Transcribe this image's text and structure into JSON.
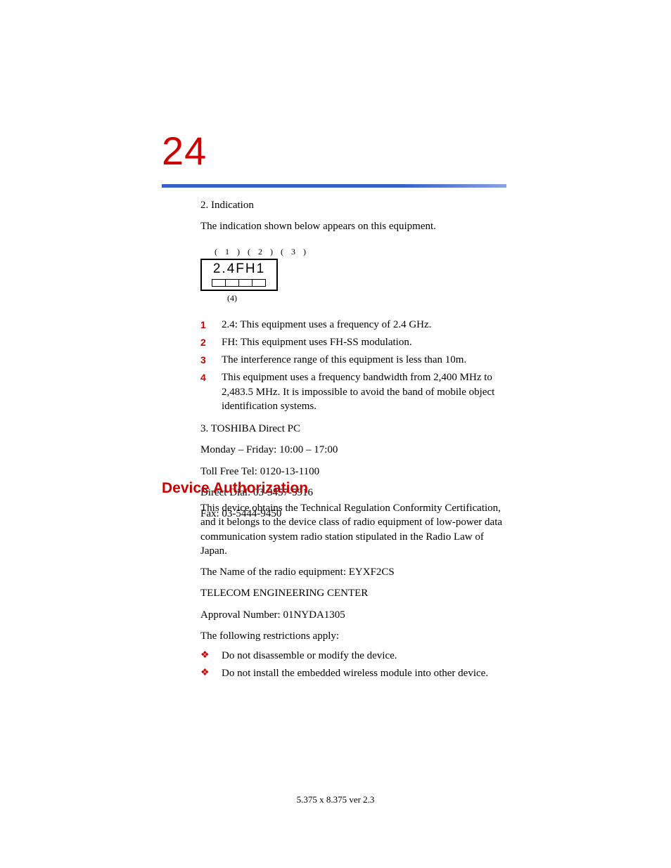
{
  "page_number": "24",
  "section1": {
    "heading": "2. Indication",
    "intro": "The indication shown below appears on this equipment.",
    "label": {
      "c1": "(1)",
      "c2": "(2)",
      "c3": "(3)",
      "c4": "(4)",
      "model": "2.4FH1"
    },
    "items": [
      {
        "num": "1",
        "text": "2.4: This equipment uses a frequency of 2.4 GHz."
      },
      {
        "num": "2",
        "text": "FH: This equipment uses FH-SS modulation."
      },
      {
        "num": "3",
        "text": "The interference range of this equipment is less than 10m."
      },
      {
        "num": "4",
        "text": "This equipment uses a frequency bandwidth from 2,400 MHz to 2,483.5 MHz. It is impossible to avoid the band of mobile object identification systems."
      }
    ],
    "contact": {
      "heading": "3. TOSHIBA Direct PC",
      "hours": "Monday – Friday: 10:00 – 17:00",
      "toll_free": "Toll Free Tel: 0120-13-1100",
      "direct_dial": "Direct Dial: 03-3457-5916",
      "fax": "Fax: 03-5444-9450"
    }
  },
  "section2": {
    "heading": "Device Authorization",
    "p1": "This device obtains the Technical Regulation Conformity Certification, and it belongs to the device class of radio equipment of low-power data communication system radio station stipulated in the Radio Law of Japan.",
    "p2": "The Name of the radio equipment: EYXF2CS",
    "p3": "TELECOM ENGINEERING CENTER",
    "p4": "Approval Number: 01NYDA1305",
    "p5": "The following restrictions apply:",
    "bullets": [
      "Do not disassemble or modify the device.",
      "Do not install the embedded wireless module into other device."
    ]
  },
  "footer": "5.375 x 8.375 ver 2.3"
}
